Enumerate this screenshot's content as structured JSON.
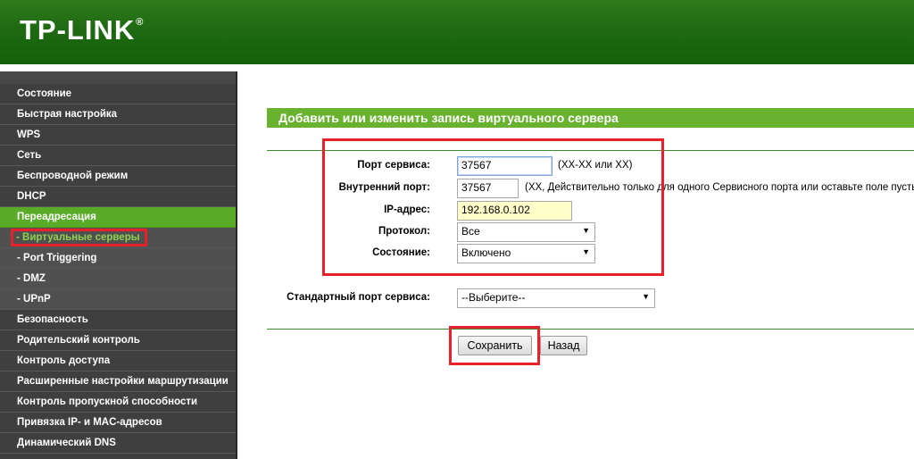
{
  "brand": {
    "name": "TP-LINK",
    "reg": "®"
  },
  "sidebar": {
    "items": [
      {
        "label": "Состояние"
      },
      {
        "label": "Быстрая настройка"
      },
      {
        "label": "WPS"
      },
      {
        "label": "Сеть"
      },
      {
        "label": "Беспроводной режим"
      },
      {
        "label": "DHCP"
      },
      {
        "label": "Переадресация"
      },
      {
        "label": "- Виртуальные серверы"
      },
      {
        "label": "- Port Triggering"
      },
      {
        "label": "- DMZ"
      },
      {
        "label": "- UPnP"
      },
      {
        "label": "Безопасность"
      },
      {
        "label": "Родительский контроль"
      },
      {
        "label": "Контроль доступа"
      },
      {
        "label": "Расширенные настройки маршрутизации"
      },
      {
        "label": "Контроль пропускной способности"
      },
      {
        "label": "Привязка IP- и MAC-адресов"
      },
      {
        "label": "Динамический DNS"
      }
    ]
  },
  "page": {
    "title": "Добавить или изменить запись виртуального сервера"
  },
  "form": {
    "service_port": {
      "label": "Порт сервиса:",
      "value": "37567",
      "hint": "(XX-XX или XX)"
    },
    "internal_port": {
      "label": "Внутренний порт:",
      "value": "37567",
      "hint": "(XX, Действительно только для одного Сервисного порта или оставьте поле пусты"
    },
    "ip_address": {
      "label": "IP-адрес:",
      "value": "192.168.0.102"
    },
    "protocol": {
      "label": "Протокол:",
      "value": "Все"
    },
    "status": {
      "label": "Состояние:",
      "value": "Включено"
    },
    "standard_port": {
      "label": "Стандартный порт сервиса:",
      "value": "--Выберите--"
    }
  },
  "buttons": {
    "save": "Сохранить",
    "back": "Назад"
  },
  "colors": {
    "header": "#1f6a12",
    "accent": "#69b22f",
    "sidebar": "#3f3f3f",
    "highlight": "#e8202a"
  }
}
